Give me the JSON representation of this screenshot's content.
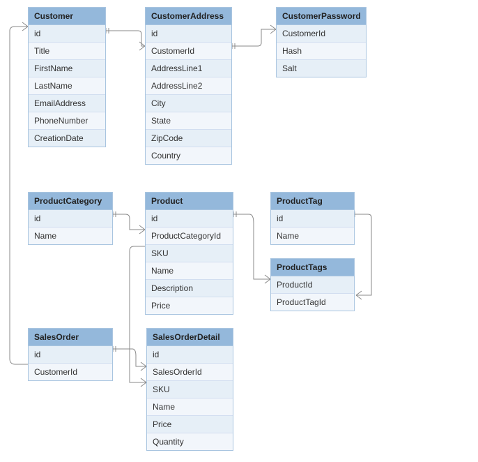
{
  "entities": {
    "customer": {
      "title": "Customer",
      "fields": [
        "id",
        "Title",
        "FirstName",
        "LastName",
        "EmailAddress",
        "PhoneNumber",
        "CreationDate"
      ]
    },
    "customerAddress": {
      "title": "CustomerAddress",
      "fields": [
        "id",
        "CustomerId",
        "AddressLine1",
        "AddressLine2",
        "City",
        "State",
        "ZipCode",
        "Country"
      ]
    },
    "customerPassword": {
      "title": "CustomerPassword",
      "fields": [
        "CustomerId",
        "Hash",
        "Salt"
      ]
    },
    "productCategory": {
      "title": "ProductCategory",
      "fields": [
        "id",
        "Name"
      ]
    },
    "product": {
      "title": "Product",
      "fields": [
        "id",
        "ProductCategoryId",
        "SKU",
        "Name",
        "Description",
        "Price"
      ]
    },
    "productTag": {
      "title": "ProductTag",
      "fields": [
        "id",
        "Name"
      ]
    },
    "productTags": {
      "title": "ProductTags",
      "fields": [
        "ProductId",
        "ProductTagId"
      ]
    },
    "salesOrder": {
      "title": "SalesOrder",
      "fields": [
        "id",
        "CustomerId"
      ]
    },
    "salesOrderDetail": {
      "title": "SalesOrderDetail",
      "fields": [
        "id",
        "SalesOrderId",
        "SKU",
        "Name",
        "Price",
        "Quantity"
      ]
    }
  }
}
